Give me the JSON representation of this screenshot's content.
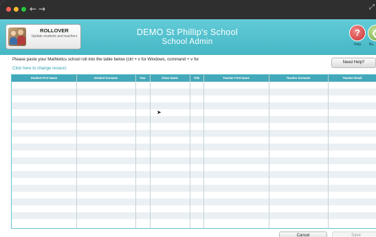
{
  "window": {
    "controls": [
      "close",
      "minimize",
      "maximize"
    ],
    "nav": {
      "back_glyph": "←",
      "forward_glyph": "→"
    }
  },
  "header": {
    "rollover": {
      "title": "ROLLOVER",
      "subtitle": "Update students and teachers"
    },
    "school_name": "DEMO St Phillip's School",
    "page_title": "School Admin",
    "help": {
      "label": "Help",
      "glyph": "?"
    },
    "back": {
      "label": "Ba",
      "glyph": "❮"
    }
  },
  "content": {
    "instructions": "Please paste your Mathletics school roll into the table below (ctrl + v for Windows, command + v for",
    "change_resource_link": "Click here to change resourc",
    "need_help_label": "Need Help?"
  },
  "table": {
    "columns": [
      "Student First Name",
      "Student Surname",
      "Year",
      "Class Name",
      "Title",
      "Teacher First Name",
      "Teacher Surname",
      "Teacher Email"
    ],
    "row_count": 21
  },
  "footer": {
    "cancel_label": "Cancel",
    "save_label": "Save"
  },
  "colors": {
    "header_teal": "#4dbcc9",
    "table_header": "#43a8b9",
    "link": "#2a9fb0",
    "help_red": "#c62d2d",
    "back_green": "#6aa33a"
  }
}
